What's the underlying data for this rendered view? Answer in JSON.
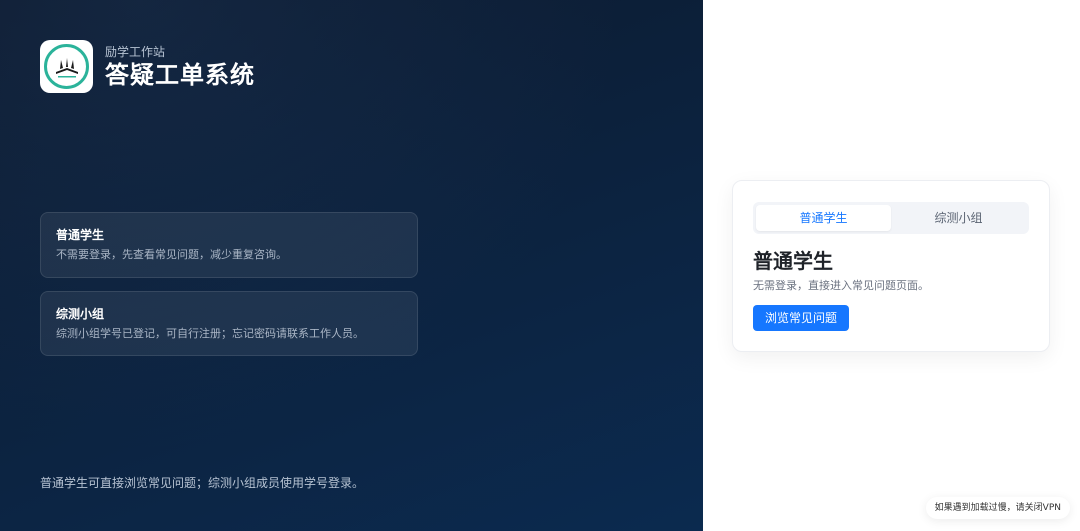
{
  "brand": {
    "subtitle": "励学工作站",
    "title": "答疑工单系统",
    "logo_icon": "school-emblem-icon"
  },
  "info_cards": [
    {
      "title": "普通学生",
      "desc": "不需要登录，先查看常见问题，减少重复咨询。"
    },
    {
      "title": "综测小组",
      "desc": "综测小组学号已登记，可自行注册；忘记密码请联系工作人员。"
    }
  ],
  "left_footer": "普通学生可直接浏览常见问题；综测小组成员使用学号登录。",
  "login": {
    "tabs": [
      {
        "label": "普通学生",
        "active": true
      },
      {
        "label": "综测小组",
        "active": false
      }
    ],
    "panel_title": "普通学生",
    "panel_desc": "无需登录，直接进入常见问题页面。",
    "button_label": "浏览常见问题"
  },
  "vpn_tip": "如果遇到加载过慢，请关闭VPN",
  "colors": {
    "accent": "#1677ff",
    "left_bg": "#0c2340",
    "logo_ring": "#2bb39a"
  }
}
